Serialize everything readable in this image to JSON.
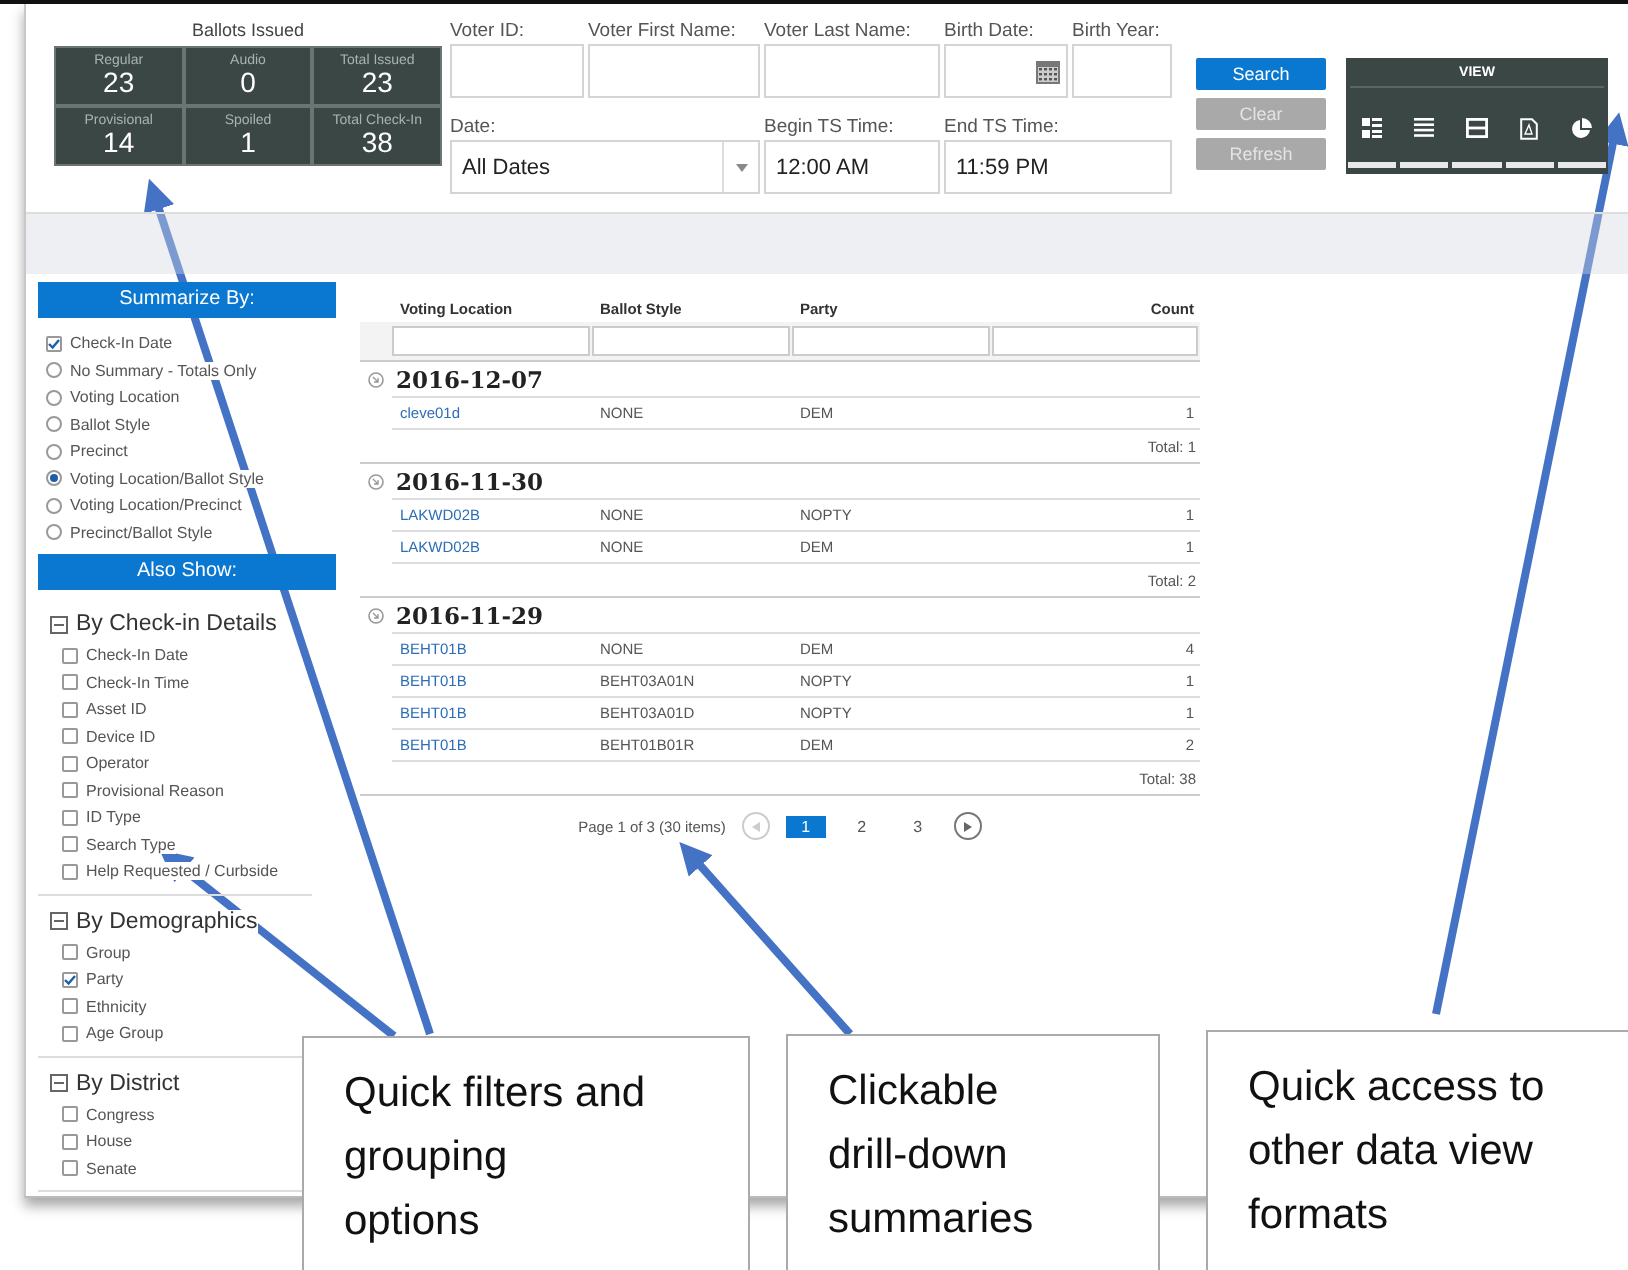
{
  "ballots_issued": {
    "title": "Ballots Issued",
    "stats": [
      {
        "label": "Regular",
        "value": "23"
      },
      {
        "label": "Audio",
        "value": "0"
      },
      {
        "label": "Total Issued",
        "value": "23"
      },
      {
        "label": "Provisional",
        "value": "14"
      },
      {
        "label": "Spoiled",
        "value": "1"
      },
      {
        "label": "Total Check-In",
        "value": "38"
      }
    ]
  },
  "search_form": {
    "fields": [
      {
        "label": "Voter ID:",
        "kind": "text"
      },
      {
        "label": "Voter First Name:",
        "kind": "text"
      },
      {
        "label": "Voter Last Name:",
        "kind": "text"
      },
      {
        "label": "Birth Date:",
        "kind": "date"
      },
      {
        "label": "Birth Year:",
        "kind": "text"
      },
      {
        "label": "Date:",
        "kind": "select",
        "value": "All Dates"
      },
      {
        "label": "Begin TS Time:",
        "kind": "text",
        "value": "12:00 AM"
      },
      {
        "label": "End TS Time:",
        "kind": "text",
        "value": "11:59 PM"
      }
    ]
  },
  "buttons": [
    {
      "label": "Search",
      "disabled": false
    },
    {
      "label": "Clear",
      "disabled": true
    },
    {
      "label": "Refresh",
      "disabled": true
    }
  ],
  "view_panel": {
    "title": "VIEW"
  },
  "summarize_by": {
    "title": "Summarize By:",
    "options": [
      {
        "label": "Check-In Date",
        "kind": "checkbox",
        "checked": true
      },
      {
        "label": "No Summary - Totals Only",
        "kind": "radio",
        "selected": false
      },
      {
        "label": "Voting Location",
        "kind": "radio",
        "selected": false
      },
      {
        "label": "Ballot Style",
        "kind": "radio",
        "selected": false
      },
      {
        "label": "Precinct",
        "kind": "radio",
        "selected": false
      },
      {
        "label": "Voting Location/Ballot Style",
        "kind": "radio",
        "selected": true
      },
      {
        "label": "Voting Location/Precinct",
        "kind": "radio",
        "selected": false
      },
      {
        "label": "Precinct/Ballot Style",
        "kind": "radio",
        "selected": false
      }
    ]
  },
  "also_show": {
    "title": "Also Show:",
    "groups": [
      {
        "title": "By Check-in Details",
        "expanded": true,
        "items": [
          {
            "label": "Check-In Date",
            "checked": false
          },
          {
            "label": "Check-In Time",
            "checked": false
          },
          {
            "label": "Asset ID",
            "checked": false
          },
          {
            "label": "Device ID",
            "checked": false
          },
          {
            "label": "Operator",
            "checked": false
          },
          {
            "label": "Provisional Reason",
            "checked": false
          },
          {
            "label": "ID Type",
            "checked": false
          },
          {
            "label": "Search Type",
            "checked": false
          },
          {
            "label": "Help Requested / Curbside",
            "checked": false
          }
        ]
      },
      {
        "title": "By Demographics",
        "expanded": true,
        "items": [
          {
            "label": "Group",
            "checked": false
          },
          {
            "label": "Party",
            "checked": true
          },
          {
            "label": "Ethnicity",
            "checked": false
          },
          {
            "label": "Age Group",
            "checked": false
          }
        ]
      },
      {
        "title": "By District",
        "expanded": true,
        "items": [
          {
            "label": "Congress",
            "checked": false
          },
          {
            "label": "House",
            "checked": false
          },
          {
            "label": "Senate",
            "checked": false
          }
        ]
      }
    ]
  },
  "table": {
    "columns": [
      "Voting Location",
      "Ballot Style",
      "Party",
      "Count"
    ],
    "groups": [
      {
        "date": "2016-12-07",
        "total": "Total: 1",
        "rows": [
          [
            "cleve01d",
            "NONE",
            "DEM",
            "1"
          ]
        ]
      },
      {
        "date": "2016-11-30",
        "total": "Total: 2",
        "rows": [
          [
            "LAKWD02B",
            "NONE",
            "NOPTY",
            "1"
          ],
          [
            "LAKWD02B",
            "NONE",
            "DEM",
            "1"
          ]
        ]
      },
      {
        "date": "2016-11-29",
        "total": "Total: 38",
        "rows": [
          [
            "BEHT01B",
            "NONE",
            "DEM",
            "4"
          ],
          [
            "BEHT01B",
            "BEHT03A01N",
            "NOPTY",
            "1"
          ],
          [
            "BEHT01B",
            "BEHT03A01D",
            "NOPTY",
            "1"
          ],
          [
            "BEHT01B",
            "BEHT01B01R",
            "DEM",
            "2"
          ]
        ]
      }
    ]
  },
  "pagination": {
    "summary": "Page 1 of 3 (30 items)",
    "pages": [
      {
        "label": "1",
        "selected": true
      },
      {
        "label": "2",
        "selected": false
      },
      {
        "label": "3",
        "selected": false
      }
    ]
  },
  "callouts": [
    {
      "text": "Quick filters and\ngrouping\noptions"
    },
    {
      "text": "Clickable\ndrill-down\nsummaries"
    },
    {
      "text": "Quick access to\nother data view\nformats"
    }
  ]
}
